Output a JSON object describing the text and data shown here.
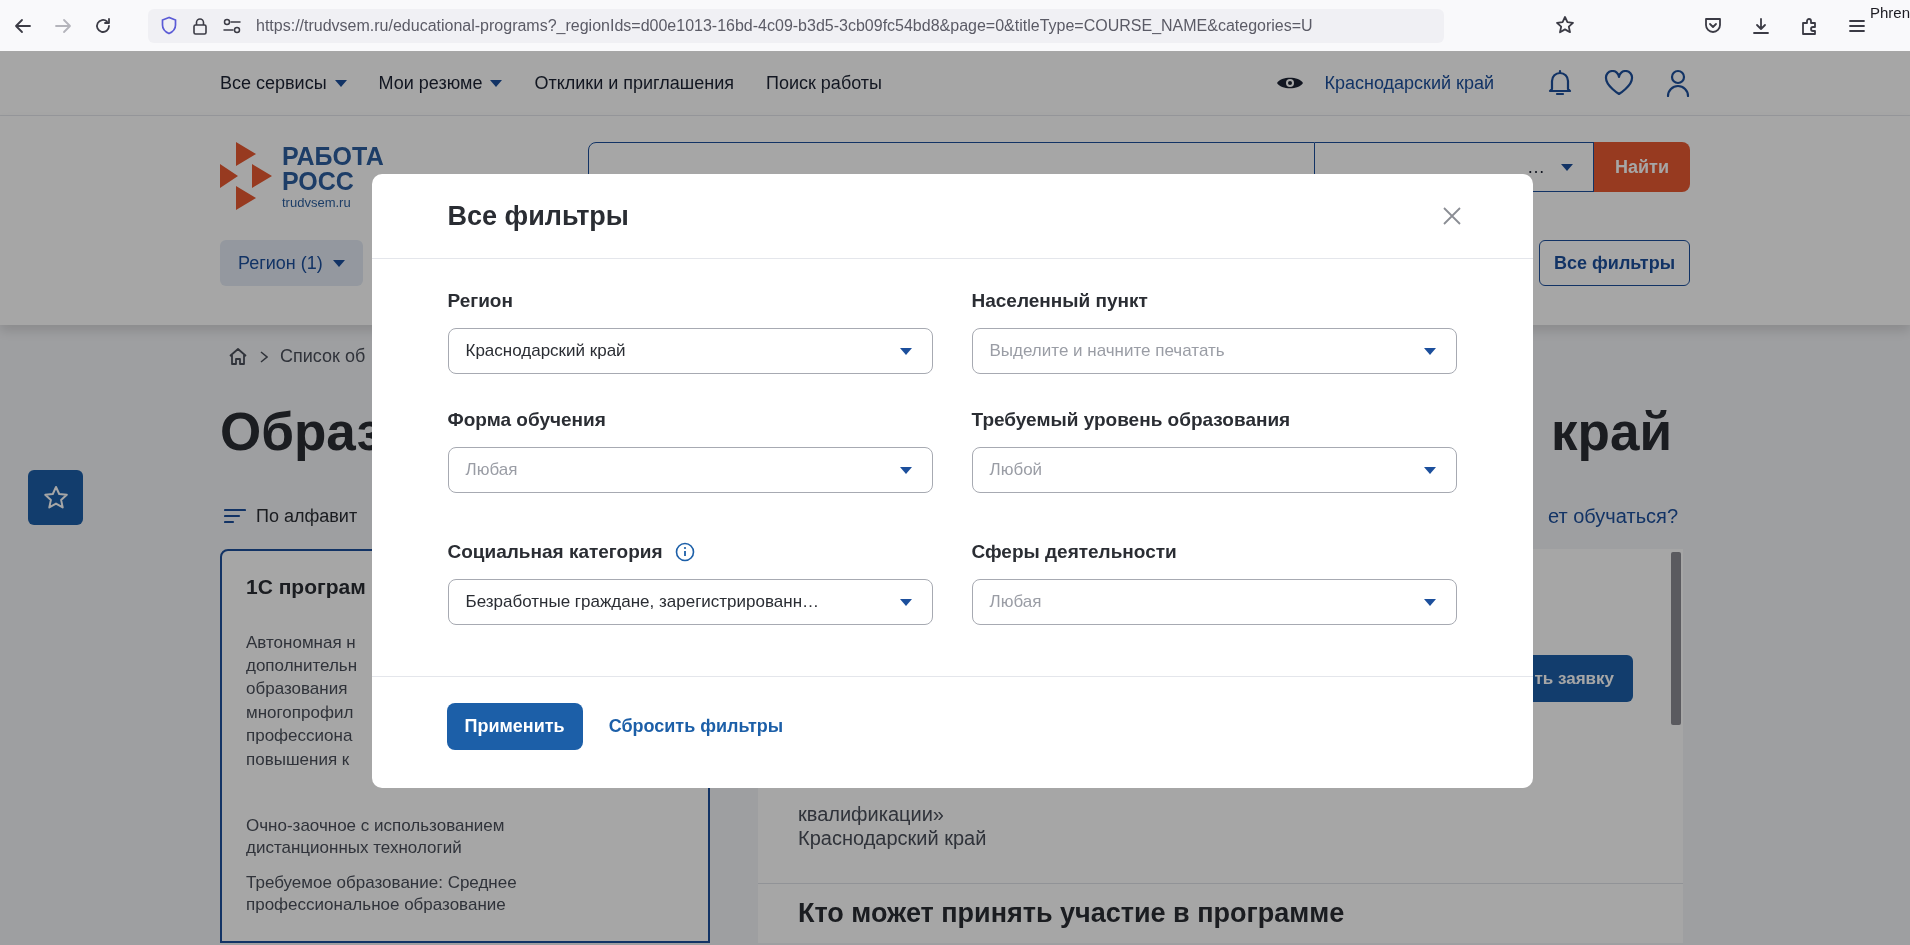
{
  "browser": {
    "url": "https://trudvsem.ru/educational-programs?_regionIds=d00e1013-16bd-4c09-b3d5-3cb09fc54bd8&page=0&titleType=COURSE_NAME&categories=U",
    "corner_text": "Phren"
  },
  "site_nav": {
    "items": [
      {
        "label": "Все сервисы",
        "dropdown": true
      },
      {
        "label": "Мои резюме",
        "dropdown": true
      },
      {
        "label": "Отклики и приглашения",
        "dropdown": false
      },
      {
        "label": "Поиск работы",
        "dropdown": false
      }
    ],
    "region": "Краснодарский край"
  },
  "header": {
    "logo": {
      "line_1": "РАБОТА",
      "line_2": "РОСС",
      "domain": "trudvsem.ru"
    },
    "search_category": "…",
    "search_button": "Найти",
    "filter_chip": "Регион (1)",
    "all_filters_button": "Все фильтры"
  },
  "page": {
    "breadcrumb": "Список об",
    "heading_left": "Образ",
    "heading_right": "край",
    "sort": "По алфавит",
    "question_link": "ет обучаться?",
    "left_card": {
      "title": "1С програм",
      "org_lines": [
        "Автономная н",
        "дополнительн",
        "образования",
        "многопрофил",
        "профессиона",
        "повышения к"
      ],
      "details": [
        "Очно-заочное с использованием\nдистанционных технологий",
        "Требуемое образование: Среднее\nпрофессиональное образование"
      ]
    },
    "right_card": {
      "button": "ть заявку",
      "lines": [
        "квалификации»",
        "Краснодарский край"
      ],
      "section_title": "Кто может принять участие в программе"
    }
  },
  "modal": {
    "title": "Все фильтры",
    "fields": [
      {
        "label": "Регион",
        "value": "Краснодарский край",
        "info": false
      },
      {
        "label": "Населенный пункт",
        "placeholder": "Выделите и начните печатать",
        "info": false
      },
      {
        "label": "Форма обучения",
        "placeholder": "Любая",
        "info": false
      },
      {
        "label": "Требуемый уровень образования",
        "placeholder": "Любой",
        "info": false
      },
      {
        "label": "Социальная категория",
        "value": "Безработные граждане, зарегистрированн…",
        "info": true
      },
      {
        "label": "Сферы деятельности",
        "placeholder": "Любая",
        "info": false
      }
    ],
    "apply_button": "Применить",
    "reset_link": "Сбросить фильтры"
  }
}
